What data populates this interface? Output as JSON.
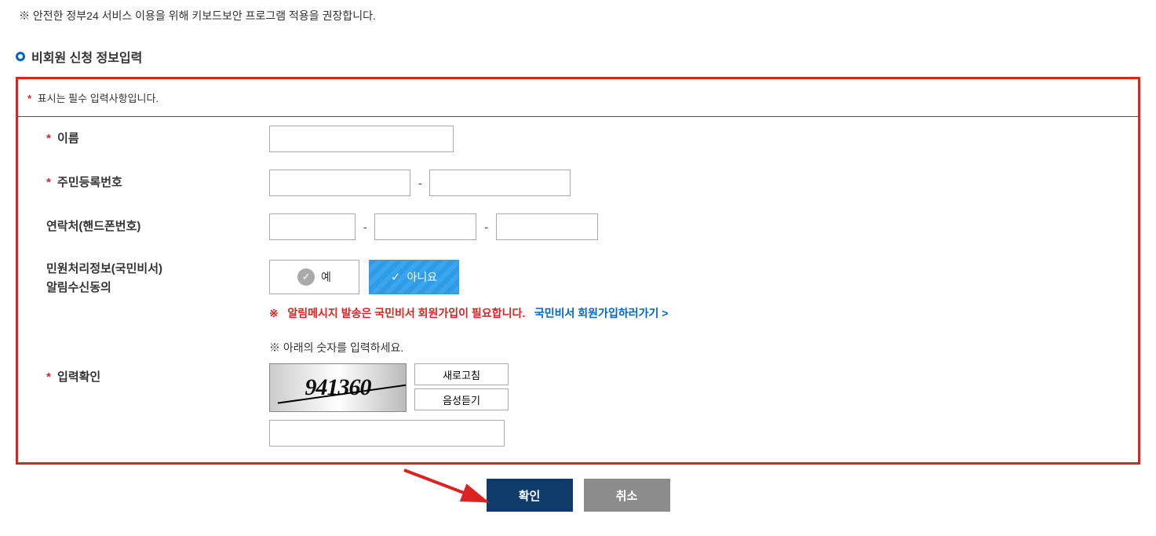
{
  "top_note": "※ 안전한 정부24 서비스 이용을 위해 키보드보안 프로그램 적용을 권장합니다.",
  "section_title": "비회원 신청 정보입력",
  "required_note": "표시는 필수 입력사항입니다.",
  "labels": {
    "name": "이름",
    "ssn": "주민등록번호",
    "phone": "연락처(핸드폰번호)",
    "notif_line1": "민원처리정보(국민비서)",
    "notif_line2": "알림수신동의",
    "verify": "입력확인"
  },
  "toggle": {
    "yes": "예",
    "no": "아니요"
  },
  "notice": {
    "prefix": "※",
    "red": "알림메시지 발송은 국민비서 회원가입이 필요합니다.",
    "link": "국민비서 회원가입하러가기 >"
  },
  "captcha": {
    "help": "※ 아래의 숫자를 입력하세요.",
    "value": "941360",
    "refresh": "새로고침",
    "audio": "음성듣기"
  },
  "actions": {
    "confirm": "확인",
    "cancel": "취소"
  },
  "dash": "-"
}
